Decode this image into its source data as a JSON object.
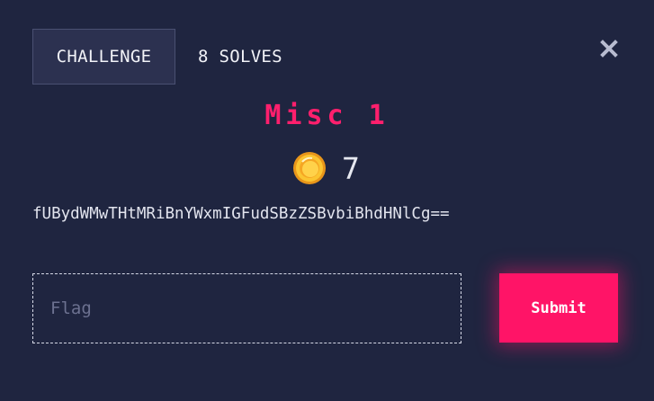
{
  "tabs": [
    {
      "label": "CHALLENGE",
      "active": true
    },
    {
      "label": "8 SOLVES",
      "active": false
    }
  ],
  "close_icon": "close-icon",
  "challenge": {
    "title": "Misc 1",
    "points": "7",
    "points_icon": "coin-icon",
    "description": "fUBydWMwTHtMRiBnYWxmIGFudSBzZSBvbiBhdHNlCg=="
  },
  "flag_input": {
    "placeholder": "Flag",
    "value": ""
  },
  "submit": {
    "label": "Submit"
  },
  "colors": {
    "background": "#1f2540",
    "accent": "#ff1467",
    "title": "#ff1f6d",
    "coin": "#f7b924"
  }
}
